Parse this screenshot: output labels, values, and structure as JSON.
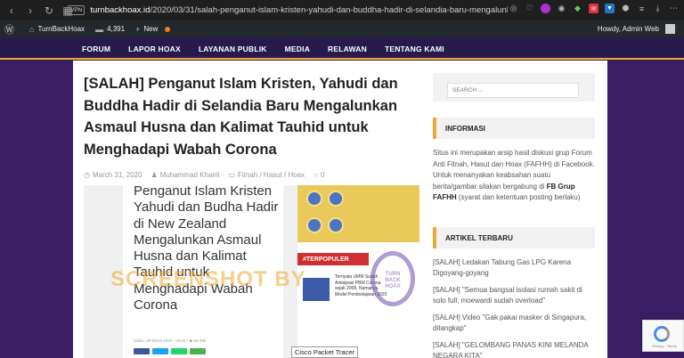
{
  "browser": {
    "url_host": "turnbackhoax.id",
    "url_path": "/2020/03/31/salah-penganut-islam-kristen-yahudi-dan-buddha-hadir-di-selandia-baru-mengalunka",
    "vpn_label": "VPN"
  },
  "admin_bar": {
    "site_name": "TurnBackHoax",
    "comment_count": "4,391",
    "new_label": "New",
    "howdy": "Howdy, Admin Web"
  },
  "menu": [
    "FORUM",
    "LAPOR HOAX",
    "LAYANAN PUBLIK",
    "MEDIA",
    "RELAWAN",
    "TENTANG KAMI"
  ],
  "article": {
    "title": "[SALAH] Penganut Islam Kristen, Yahudi dan Buddha Hadir di Selandia Baru Mengalunkan Asmaul Husna dan Kalimat Tauhid untuk Menghadapi Wabah Corona",
    "date": "March 31, 2020",
    "author": "Muhammad Khairil",
    "category": "Fitnah / Hasut / Hoax",
    "comments": "0"
  },
  "featured": {
    "phone_headline": "Penganut Islam Kristen Yahudi dan Budha Hadir di New Zealand Mengalunkan Asmaul Husna dan Kalimat Tauhid untuk Menghadapi Wabah Corona",
    "phone_meta": "Sabtu, 28 Maret 2020 - 20:04 | ◉ 52.29k",
    "watermark": "SCREENSHOT BY",
    "terpopuler": "#TERPOPULER",
    "popular_text": "Ternyata UMM Sudah Antisipasi PBM Corona sejak 2009, Namanya Model Pembelajaran 2020",
    "seal_text": "TURN BACK HOAX",
    "share_colors": [
      "#3b5998",
      "#1da1f2",
      "#25d366",
      "#4caf50"
    ]
  },
  "sidebar": {
    "search_placeholder": "SEARCH ...",
    "info_title": "INFORMASI",
    "info_text": "Situs ini merupakan arsip hasil diskusi grup Forum Anti Fitnah, Hasut dan Hoax (FAFHH) di Facebook. Untuk menanyakan keabsahan suatu berita/gambar silakan bergabung di ",
    "info_link": "FB Grup FAFHH",
    "info_tail": " (syarat dan ketentuan posting berlaku)",
    "recent_title": "ARTIKEL TERBARU",
    "recent_posts": [
      "[SALAH] Ledakan Tabung Gas LPG Karena Digoyang-goyang",
      "[SALAH] \"Semua bangsal isolasi rumah sakit di solo full, moewardi sudah overload\"",
      "[SALAH] Video \"Gak pakai masker di Singapura, ditangkap\"",
      "[SALAH] \"GELOMBANG PANAS KINI MELANDA NEGARA KITA\""
    ]
  },
  "tooltip": "Cisco Packet Tracer",
  "recaptcha": "Privacy - Terms",
  "colors": {
    "accent": "#f0a830",
    "nav_bg": "#281a4d",
    "page_bg": "#3a1e63"
  }
}
